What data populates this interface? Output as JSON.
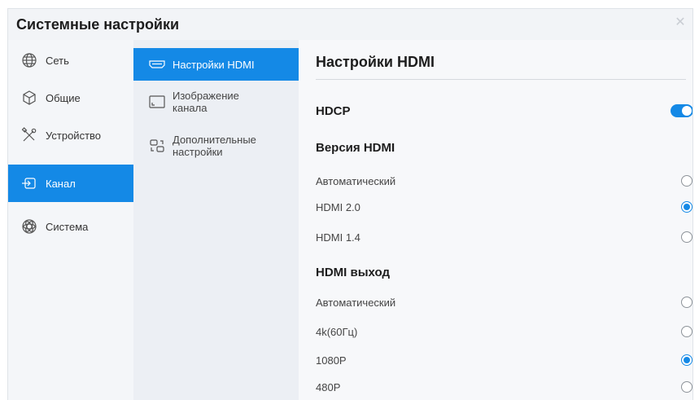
{
  "window": {
    "title": "Системные настройки",
    "close_icon": "close-icon"
  },
  "nav": {
    "items": [
      {
        "label": "Сеть",
        "icon": "globe-icon"
      },
      {
        "label": "Общие",
        "icon": "cube-icon"
      },
      {
        "label": "Устройство",
        "icon": "tools-icon"
      },
      {
        "label": "Канал",
        "icon": "input-channel-icon"
      },
      {
        "label": "Система",
        "icon": "system-icon"
      }
    ],
    "active": "Канал"
  },
  "subnav": {
    "items": [
      {
        "label": "Настройки HDMI",
        "icon": "hdmi-port-icon"
      },
      {
        "label": "Изображение канала",
        "icon": "channel-image-icon"
      },
      {
        "label": "Дополнительные настройки",
        "icon": "advanced-settings-icon"
      }
    ],
    "active": "Настройки HDMI"
  },
  "content": {
    "title": "Настройки HDMI",
    "hdcp": {
      "label": "HDCP",
      "enabled": true
    },
    "hdmi_version": {
      "heading": "Версия HDMI",
      "options": [
        {
          "label": "Автоматический",
          "selected": false
        },
        {
          "label": "HDMI 2.0",
          "selected": true
        },
        {
          "label": "HDMI 1.4",
          "selected": false
        }
      ]
    },
    "hdmi_output": {
      "heading": "HDMI выход",
      "options": [
        {
          "label": "Автоматический",
          "selected": false
        },
        {
          "label": "4k(60Гц)",
          "selected": false
        },
        {
          "label": "1080P",
          "selected": true
        },
        {
          "label": "480P",
          "selected": false
        }
      ]
    }
  },
  "colors": {
    "accent": "#1489e6",
    "background": "#f4f6f9"
  }
}
